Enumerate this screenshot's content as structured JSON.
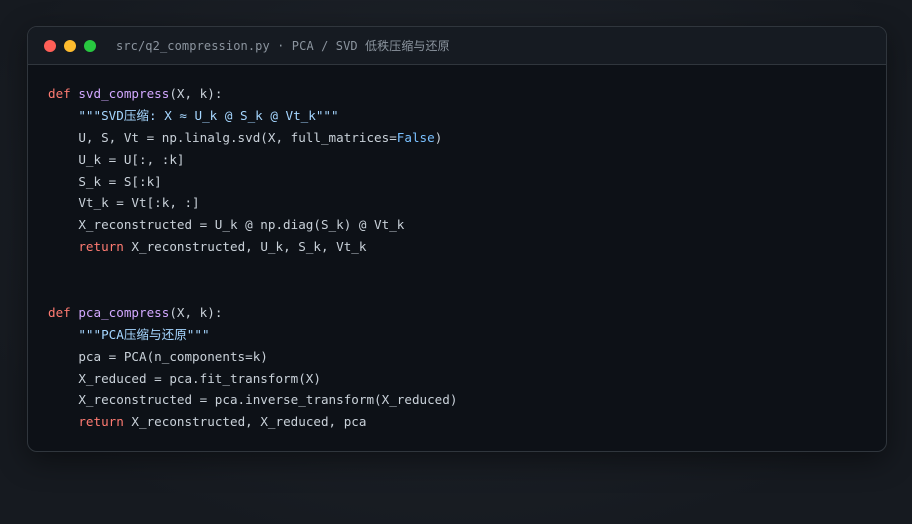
{
  "window": {
    "title": "src/q2_compression.py · PCA / SVD 低秩压缩与还原",
    "traffic_lights": [
      {
        "name": "close",
        "color": "#ff5f57"
      },
      {
        "name": "minimize",
        "color": "#febc2e"
      },
      {
        "name": "maximize",
        "color": "#28c840"
      }
    ]
  },
  "theme": {
    "keyword": "#ff7b72",
    "function": "#d2a8ff",
    "string": "#a5d6ff",
    "boolean": "#79c0ff",
    "text": "#c9d1d9"
  },
  "code": {
    "lines": [
      [
        {
          "t": "def",
          "c": "kw"
        },
        {
          "t": " ",
          "c": "plain"
        },
        {
          "t": "svd_compress",
          "c": "fn"
        },
        {
          "t": "(X, k):",
          "c": "plain"
        }
      ],
      [
        {
          "t": "    ",
          "c": "plain"
        },
        {
          "t": "\"\"\"SVD压缩: X ≈ U_k @ S_k @ Vt_k\"\"\"",
          "c": "str"
        }
      ],
      [
        {
          "t": "    U, S, Vt = np.linalg.svd(X, full_matrices=",
          "c": "plain"
        },
        {
          "t": "False",
          "c": "bool"
        },
        {
          "t": ")",
          "c": "plain"
        }
      ],
      [
        {
          "t": "    U_k = U[:, :k]",
          "c": "plain"
        }
      ],
      [
        {
          "t": "    S_k = S[:k]",
          "c": "plain"
        }
      ],
      [
        {
          "t": "    Vt_k = Vt[:k, :]",
          "c": "plain"
        }
      ],
      [
        {
          "t": "    X_reconstructed = U_k @ np.diag(S_k) @ Vt_k",
          "c": "plain"
        }
      ],
      [
        {
          "t": "    ",
          "c": "plain"
        },
        {
          "t": "return",
          "c": "kw"
        },
        {
          "t": " X_reconstructed, U_k, S_k, Vt_k",
          "c": "plain"
        }
      ],
      [],
      [],
      [
        {
          "t": "def",
          "c": "kw"
        },
        {
          "t": " ",
          "c": "plain"
        },
        {
          "t": "pca_compress",
          "c": "fn"
        },
        {
          "t": "(X, k):",
          "c": "plain"
        }
      ],
      [
        {
          "t": "    ",
          "c": "plain"
        },
        {
          "t": "\"\"\"PCA压缩与还原\"\"\"",
          "c": "str"
        }
      ],
      [
        {
          "t": "    pca = PCA(n_components=k)",
          "c": "plain"
        }
      ],
      [
        {
          "t": "    X_reduced = pca.fit_transform(X)",
          "c": "plain"
        }
      ],
      [
        {
          "t": "    X_reconstructed = pca.inverse_transform(X_reduced)",
          "c": "plain"
        }
      ],
      [
        {
          "t": "    ",
          "c": "plain"
        },
        {
          "t": "return",
          "c": "kw"
        },
        {
          "t": " X_reconstructed, X_reduced, pca",
          "c": "plain"
        }
      ]
    ]
  }
}
